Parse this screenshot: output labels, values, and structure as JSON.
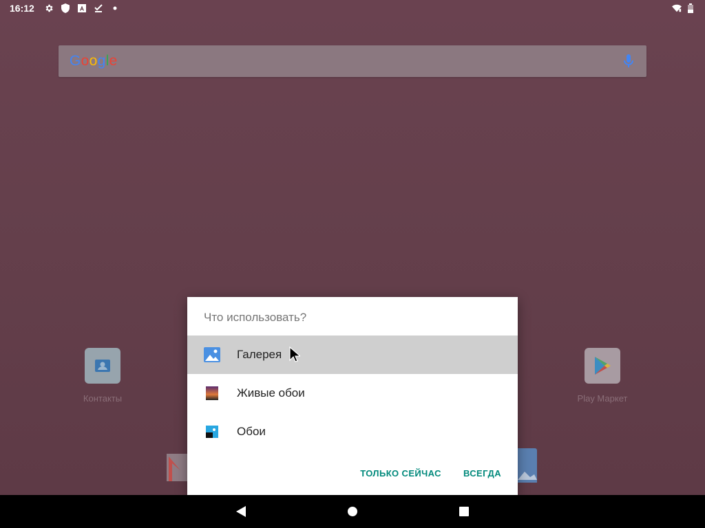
{
  "status_bar": {
    "time": "16:12",
    "icons_left": [
      "gear-icon",
      "shield-icon",
      "a-box-icon",
      "checklist-icon",
      "dot-icon"
    ],
    "icons_right": [
      "wifi-icon",
      "battery-icon"
    ]
  },
  "search": {
    "logo": "Google",
    "mic": "mic-icon"
  },
  "home_apps": [
    {
      "label": "Контакты",
      "icon": "contacts-icon"
    },
    {
      "label": "Play Маркет",
      "icon": "play-store-icon"
    }
  ],
  "dialog": {
    "title": "Что использовать?",
    "items": [
      {
        "label": "Галерея",
        "icon": "gallery-icon",
        "selected": true
      },
      {
        "label": "Живые обои",
        "icon": "live-wallpaper-icon",
        "selected": false
      },
      {
        "label": "Обои",
        "icon": "wallpapers-icon",
        "selected": false
      }
    ],
    "actions": {
      "just_once": "ТОЛЬКО СЕЙЧАС",
      "always": "ВСЕГДА"
    },
    "accent_color": "#00897b"
  },
  "nav_bar": {
    "buttons": [
      "back-icon",
      "home-icon",
      "recents-icon"
    ]
  }
}
